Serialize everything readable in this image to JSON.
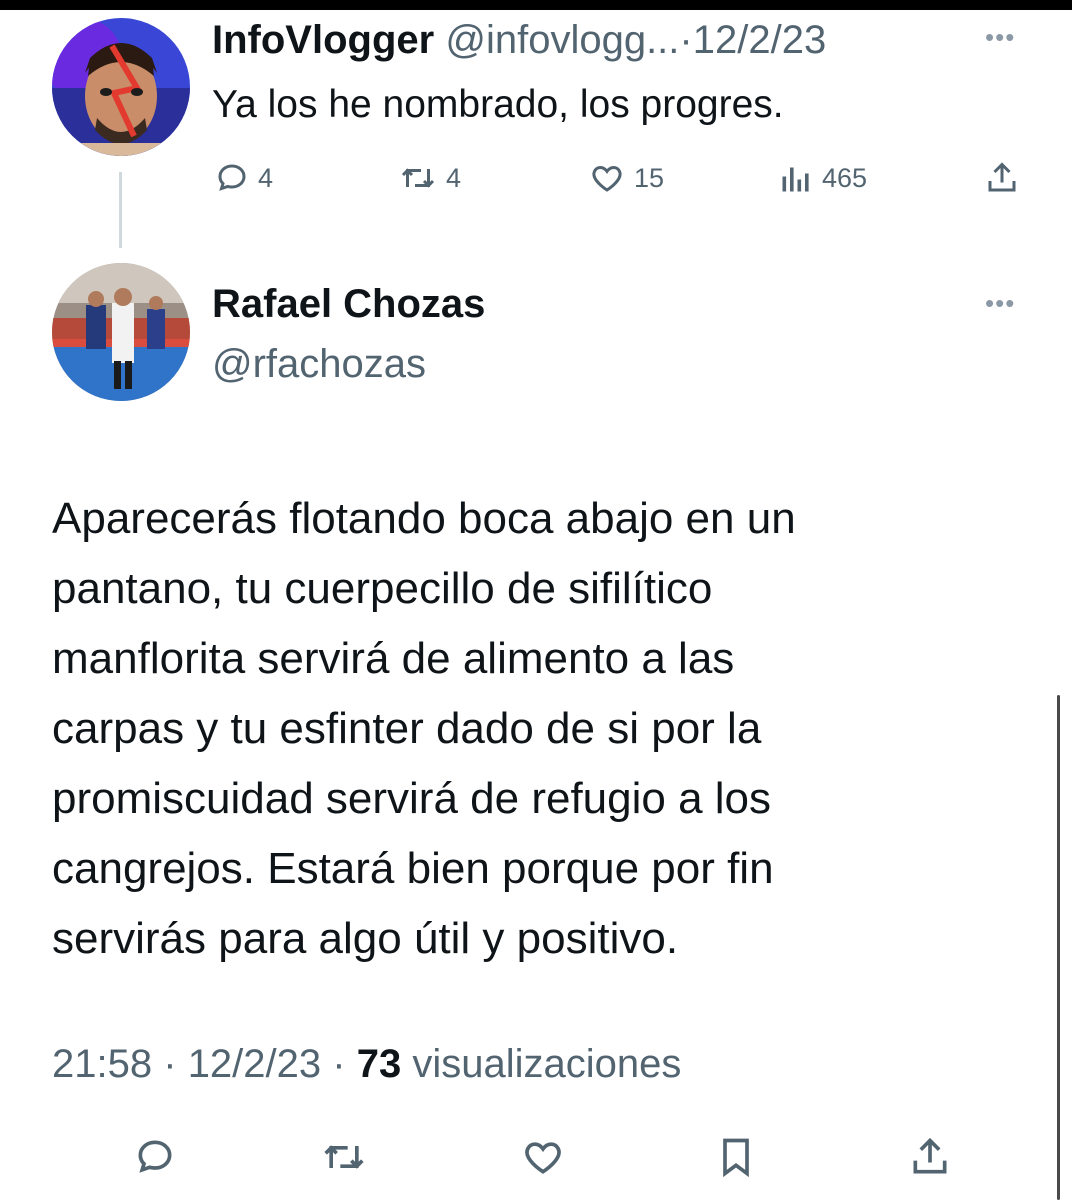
{
  "tweet1": {
    "display_name": "InfoVlogger",
    "handle": "@infovlogg...",
    "separator": "·",
    "date": "12/2/23",
    "text": "Ya los he nombrado, los progres.",
    "actions": {
      "replies": "4",
      "retweets": "4",
      "likes": "15",
      "views": "465"
    }
  },
  "tweet2": {
    "display_name": "Rafael Chozas",
    "handle": "@rfachozas",
    "text_lines": [
      "Aparecerás flotando boca abajo en un",
      "pantano, tu cuerpecillo de sifilítico",
      "manflorita servirá de alimento a las",
      "carpas y tu esfinter dado de si por la",
      "promiscuidad servirá de refugio a los",
      "cangrejos. Estará bien porque por fin",
      "servirás para algo útil y positivo."
    ],
    "time": "21:58",
    "date": "12/2/23",
    "separator": "·",
    "views_count": "73",
    "views_label": "visualizaciones"
  },
  "icons": {
    "reply": "speech-bubble-icon",
    "retweet": "retweet-arrows-icon",
    "like": "heart-icon",
    "views": "bar-chart-icon",
    "share": "share-upload-icon",
    "bookmark": "bookmark-icon",
    "more": "ellipsis-icon"
  },
  "colors": {
    "text_primary": "#0f1419",
    "text_secondary": "#536471",
    "thread_line": "#cfd9de"
  }
}
